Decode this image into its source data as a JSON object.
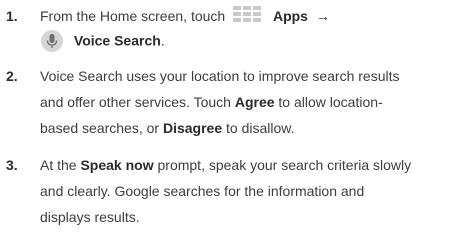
{
  "steps": [
    {
      "number": "1.",
      "line1_text": "From the Home screen, touch",
      "apps_label": "Apps",
      "arrow": "→",
      "voice_search_label": "Voice Search",
      "line2_end": ".",
      "apps_icon": "apps-grid-icon",
      "mic_icon": "microphone-icon"
    },
    {
      "number": "2.",
      "line1": "Voice Search uses your location to improve search results",
      "line2_pre": "and offer other services. Touch ",
      "agree": "Agree",
      "line2_post": " to allow location-",
      "line3_pre": "based searches, or ",
      "disagree": "Disagree",
      "line3_post": " to disallow."
    },
    {
      "number": "3.",
      "line1_pre": "At the ",
      "speak_now": "Speak now",
      "line1_post": " prompt, speak your search criteria slowly",
      "line2": "and clearly. Google searches for the information and",
      "line3": "displays results."
    }
  ],
  "colors": {
    "text": "#3d3d3d",
    "bold_text": "#2b2b2b",
    "apps_icon_fill": "#c9c9c9",
    "mic_icon_fill": "#d6d6d6"
  }
}
